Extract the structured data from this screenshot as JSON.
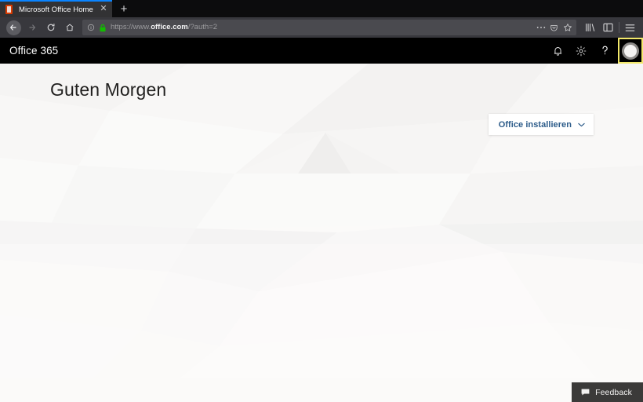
{
  "browser": {
    "tab": {
      "title": "Microsoft Office Home",
      "favicon": "office-favicon",
      "close_label": "✕"
    },
    "newtab_label": "+",
    "nav": {
      "back_icon": "back-arrow-icon",
      "forward_icon": "forward-arrow-icon",
      "reload_icon": "reload-icon",
      "home_icon": "home-icon"
    },
    "url": {
      "prefix": "https://www.",
      "domain": "office.com",
      "suffix": "/?auth=2",
      "identity_icon": "page-info-icon",
      "lock_icon": "padlock-icon",
      "lock_color": "#12bc00",
      "page_actions_icon": "ellipsis-icon",
      "pocket_icon": "pocket-icon",
      "bookmark_icon": "star-icon"
    },
    "toolbar_right": {
      "library_icon": "library-icon",
      "sidebar_icon": "sidebar-icon",
      "menu_icon": "hamburger-menu-icon"
    }
  },
  "page": {
    "suite_bar": {
      "title": "Office 365",
      "notifications_icon": "bell-icon",
      "settings_icon": "gear-icon",
      "help_icon": "question-mark-icon",
      "avatar_icon": "user-avatar",
      "background_color": "#000000",
      "focus_ring_color": "#f2e86a"
    },
    "greeting": "Guten Morgen",
    "install_button": {
      "label": "Office installieren",
      "chevron_icon": "chevron-down-icon",
      "text_color": "#2d5c8a"
    },
    "feedback_button": {
      "label": "Feedback",
      "icon": "speech-bubble-icon",
      "background_color": "#3b3a39"
    },
    "background_color": "#fbfaf9"
  }
}
